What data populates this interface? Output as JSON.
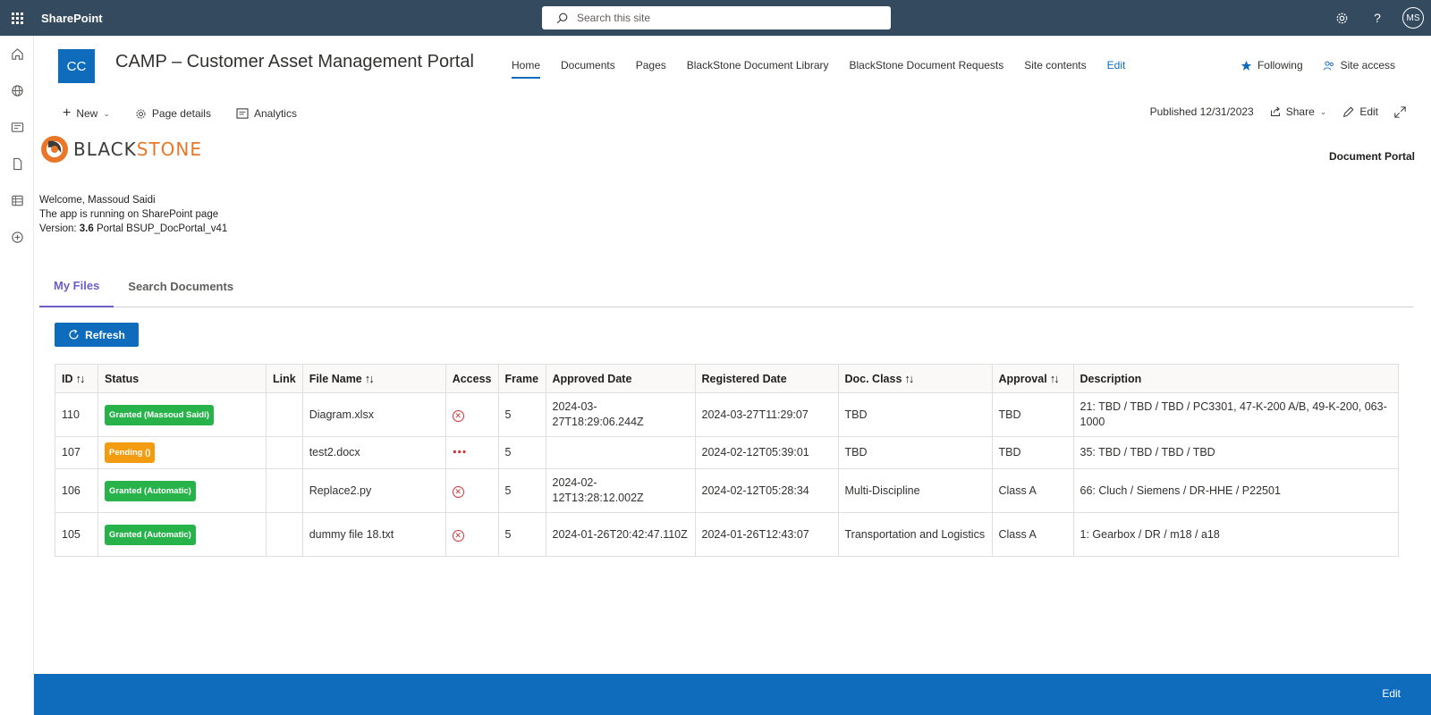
{
  "suite": {
    "brand": "SharePoint",
    "search_placeholder": "Search this site",
    "avatar_initials": "MS"
  },
  "site": {
    "logo_initials": "CC",
    "title": "CAMP – Customer Asset Management Portal",
    "nav": [
      "Home",
      "Documents",
      "Pages",
      "BlackStone Document Library",
      "BlackStone Document Requests",
      "Site contents",
      "Edit"
    ],
    "following": "Following",
    "site_access": "Site access"
  },
  "command": {
    "new": "New",
    "page_details": "Page details",
    "analytics": "Analytics",
    "published": "Published 12/31/2023",
    "share": "Share",
    "edit": "Edit"
  },
  "content": {
    "logo_black": "BLACK",
    "logo_orange": "STONE",
    "doc_portal": "Document Portal",
    "welcome_line": "Welcome, Massoud Saidi",
    "running_line": "The app is running on SharePoint page",
    "version_prefix": "Version: ",
    "version_number": "3.6",
    "version_suffix": " Portal BSUP_DocPortal_v41"
  },
  "tabs": [
    "My Files",
    "Search Documents"
  ],
  "refresh_label": "Refresh",
  "table": {
    "headers": [
      "ID",
      "Status",
      "Link",
      "File Name",
      "Access",
      "Frame",
      "Approved Date",
      "Registered Date",
      "Doc. Class",
      "Approval",
      "Description"
    ],
    "rows": [
      {
        "id": "110",
        "status": "Granted (Massoud Saidi)",
        "status_color": "green",
        "link": "",
        "file": "Diagram.xlsx",
        "access": "denied",
        "frame": "5",
        "approved": "2024-03-27T18:29:06.244Z",
        "registered": "2024-03-27T11:29:07",
        "doc_class": "TBD",
        "approval": "TBD",
        "description": "21: TBD / TBD / TBD / PC3301, 47-K-200 A/B, 49-K-200, 063-1000"
      },
      {
        "id": "107",
        "status": "Pending ()",
        "status_color": "orange",
        "link": "",
        "file": "test2.docx",
        "access": "pending",
        "frame": "5",
        "approved": "",
        "registered": "2024-02-12T05:39:01",
        "doc_class": "TBD",
        "approval": "TBD",
        "description": "35: TBD / TBD / TBD / TBD"
      },
      {
        "id": "106",
        "status": "Granted (Automatic)",
        "status_color": "green",
        "link": "",
        "file": "Replace2.py",
        "access": "denied",
        "frame": "5",
        "approved": "2024-02-12T13:28:12.002Z",
        "registered": "2024-02-12T05:28:34",
        "doc_class": "Multi-Discipline",
        "approval": "Class A",
        "description": "66: Cluch / Siemens / DR-HHE / P22501"
      },
      {
        "id": "105",
        "status": "Granted (Automatic)",
        "status_color": "green",
        "link": "",
        "file": "dummy file 18.txt",
        "access": "denied",
        "frame": "5",
        "approved": "2024-01-26T20:42:47.110Z",
        "registered": "2024-01-26T12:43:07",
        "doc_class": "Transportation and Logistics",
        "approval": "Class A",
        "description": "1: Gearbox / DR / m18 / a18"
      }
    ]
  },
  "footer_edit": "Edit",
  "colors": {
    "suite_bar": "#344a5e",
    "accent": "#0f6cbd",
    "tab_active": "#6b5fc7",
    "granted": "#28b34a",
    "pending": "#f39c12",
    "denied": "#d13438",
    "logo_orange": "#e9772a"
  }
}
